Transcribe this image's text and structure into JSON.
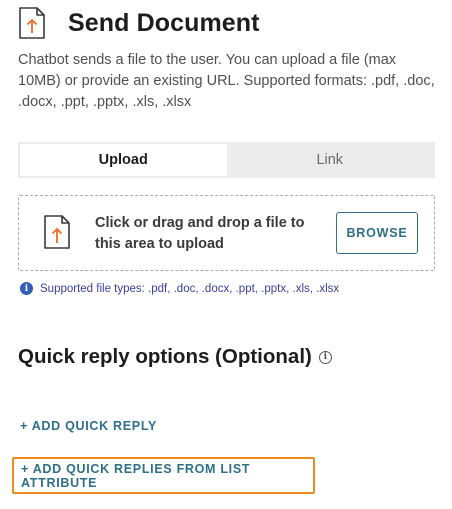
{
  "header": {
    "title": "Send Document",
    "icon": "file-upload-icon"
  },
  "description": "Chatbot sends a file to the user. You can upload a file (max 10MB) or provide an existing URL. Supported formats: .pdf, .doc, .docx, .ppt, .pptx, .xls, .xlsx",
  "tabs": [
    {
      "label": "Upload",
      "active": true
    },
    {
      "label": "Link",
      "active": false
    }
  ],
  "dropzone": {
    "text": "Click or drag and drop a file to this area to upload",
    "browse_label": "BROWSE",
    "icon": "file-upload-icon"
  },
  "supported_types": "Supported file types: .pdf, .doc, .docx, .ppt, .pptx, .xls, .xlsx",
  "quick_reply": {
    "title": "Quick reply options (Optional)",
    "add_label": "+ ADD QUICK REPLY",
    "add_from_list_label": "+ ADD QUICK REPLIES FROM LIST ATTRIBUTE"
  },
  "colors": {
    "accent": "#2e6f8a",
    "upload_arrow": "#ef6c23",
    "focus_outline": "#ef8a1f",
    "info": "#3b3fa0"
  }
}
